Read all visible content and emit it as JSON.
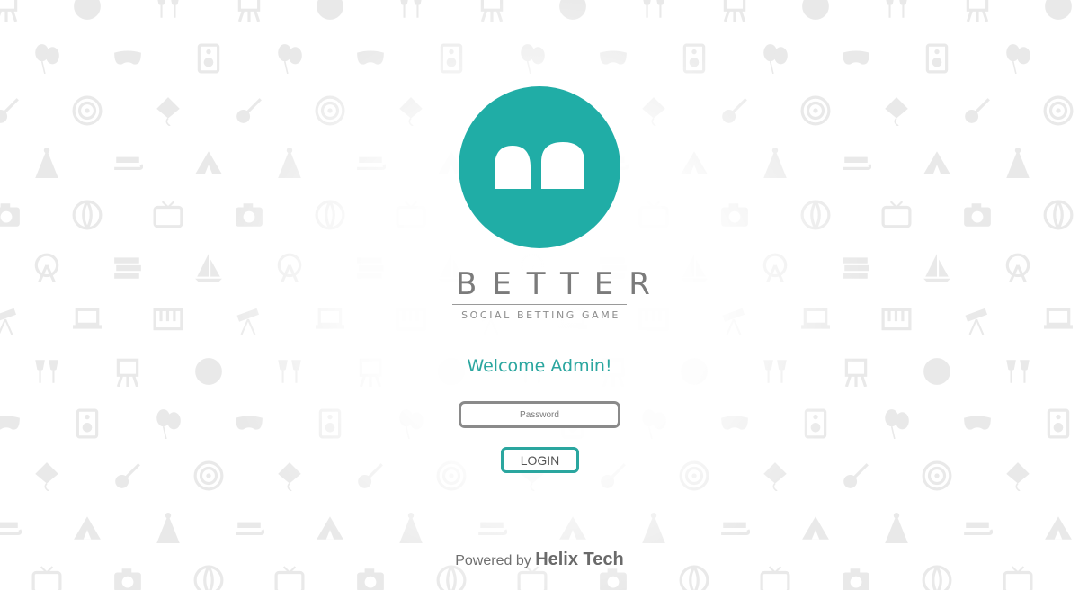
{
  "brand": {
    "name": "BETTER",
    "tagline": "SOCIAL BETTING GAME",
    "logo_color": "#20ada6"
  },
  "welcome": {
    "text": "Welcome Admin!"
  },
  "form": {
    "password_placeholder": "Password",
    "password_value": "",
    "login_label": "LOGIN"
  },
  "footer": {
    "prefix": "Powered by",
    "company": "Helix Tech"
  },
  "colors": {
    "accent": "#2aa69f",
    "text_gray": "#7b7b7b",
    "pattern": "#e9e9e9",
    "background": "#ffffff"
  },
  "background_icons": [
    "easel-icon",
    "sailboat-icon",
    "party-hat-icon",
    "mask-icon",
    "laptop-icon",
    "television-icon",
    "guitar-icon",
    "disco-ball-icon",
    "ferris-wheel-icon",
    "sled-icon",
    "speaker-icon",
    "piano-icon",
    "camera-icon",
    "dartboard-icon",
    "wine-glasses-icon",
    "books-icon",
    "tent-icon",
    "balloons-icon",
    "telescope-icon",
    "beach-ball-icon",
    "kite-icon"
  ]
}
